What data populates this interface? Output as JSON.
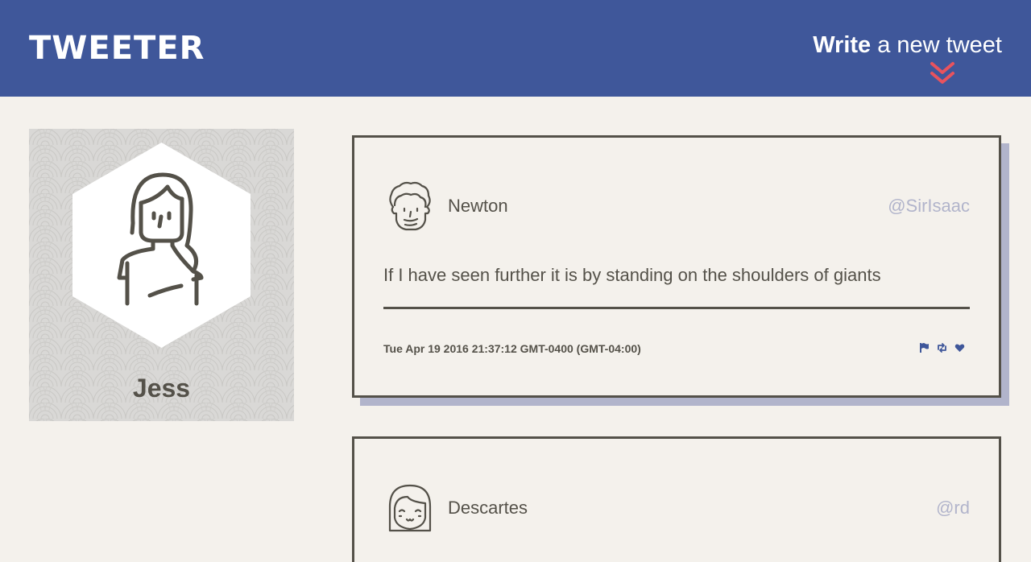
{
  "header": {
    "logo": "TWEETER",
    "compose_strong": "Write",
    "compose_rest": " a new tweet",
    "compose_arrow_icon": "double-chevron-down-icon"
  },
  "profile": {
    "name": "Jess",
    "avatar_icon": "woman-avatar-icon"
  },
  "tweets": [
    {
      "author": "Newton",
      "handle": "@SirIsaac",
      "avatar_icon": "curly-hair-man-avatar-icon",
      "content": "If I have seen further it is by standing on the shoulders of giants",
      "timestamp": "Tue Apr 19 2016 21:37:12 GMT-0400 (GMT-04:00)",
      "actions": [
        "flag-icon",
        "retweet-icon",
        "heart-icon"
      ]
    },
    {
      "author": "Descartes",
      "handle": "@rd",
      "avatar_icon": "bob-hair-avatar-icon"
    }
  ],
  "colors": {
    "nav": "#3f579a",
    "background": "#f4f1ec",
    "text": "#545149",
    "handle": "#b1b4cb",
    "accent_arrow": "#e8535e",
    "action_icons": "#3f579a",
    "shadow": "#b1b4cb"
  }
}
